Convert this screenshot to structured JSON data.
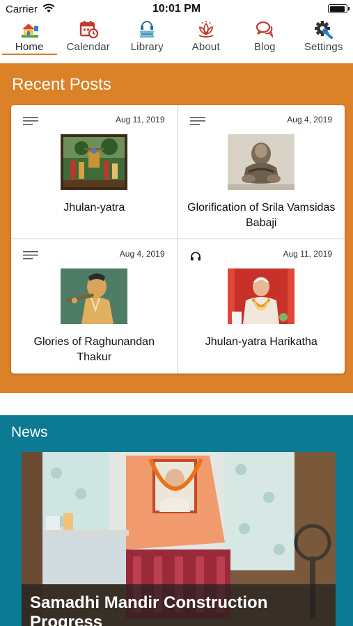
{
  "status_bar": {
    "carrier": "Carrier",
    "time": "10:01 PM"
  },
  "tabs": [
    {
      "label": "Home",
      "icon": "home-icon",
      "active": true
    },
    {
      "label": "Calendar",
      "icon": "calendar-icon",
      "active": false
    },
    {
      "label": "Library",
      "icon": "library-icon",
      "active": false
    },
    {
      "label": "About",
      "icon": "lotus-icon",
      "active": false
    },
    {
      "label": "Blog",
      "icon": "chat-bubble-icon",
      "active": false
    },
    {
      "label": "Settings",
      "icon": "gear-icon",
      "active": false
    }
  ],
  "recent_posts": {
    "title": "Recent Posts",
    "posts": [
      {
        "type_icon": "text-lines-icon",
        "date": "Aug 11, 2019",
        "title": "Jhulan-yatra"
      },
      {
        "type_icon": "text-lines-icon",
        "date": "Aug 4, 2019",
        "title": "Glorification of Srila Vamsidas Babaji"
      },
      {
        "type_icon": "text-lines-icon",
        "date": "Aug 4, 2019",
        "title": "Glories of Raghunandan Thakur"
      },
      {
        "type_icon": "headphones-icon",
        "date": "Aug 11, 2019",
        "title": "Jhulan-yatra Harikatha"
      }
    ]
  },
  "news": {
    "title": "News",
    "items": [
      {
        "title": "Samadhi Mandir Construction Progress"
      }
    ]
  },
  "colors": {
    "recent_posts_bg": "#db8128",
    "news_bg": "#0b7a92",
    "tab_active_underline": "#e07b2a"
  }
}
